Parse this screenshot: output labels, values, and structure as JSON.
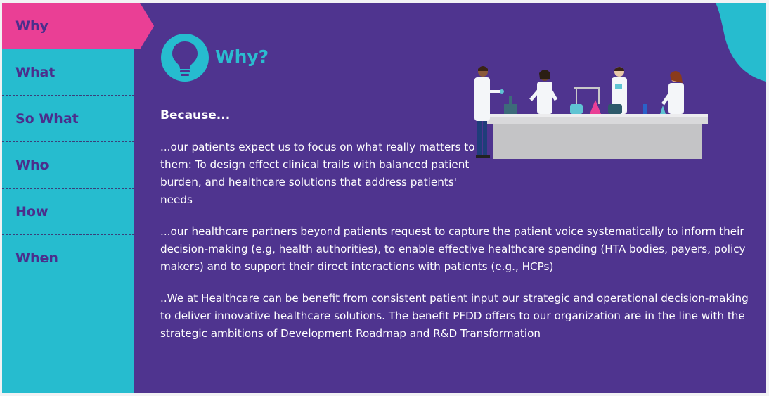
{
  "nav": {
    "items": [
      {
        "label": "Why",
        "active": true
      },
      {
        "label": "What",
        "active": false
      },
      {
        "label": "So What",
        "active": false
      },
      {
        "label": "Who",
        "active": false
      },
      {
        "label": "How",
        "active": false
      },
      {
        "label": "When",
        "active": false
      }
    ]
  },
  "main": {
    "heading": "Why?",
    "intro": "Because...",
    "paragraphs": [
      "...our patients expect us to focus on what really matters to them: To design effect clinical trails with balanced patient burden, and healthcare solutions that address patients' needs",
      "...our healthcare partners beyond patients request to capture the patient voice systematically to inform their decision-making (e.g, health authorities), to enable effective healthcare spending (HTA bodies, payers, policy makers) and to support their direct interactions with patients (e.g., HCPs)",
      "..We at Healthcare can be benefit from consistent patient input our strategic and operational decision-making to deliver innovative healthcare solutions. The benefit PFDD offers to our organization are in the line with the strategic ambitions of Development Roadmap and R&D Transformation"
    ]
  },
  "icons": {
    "header_icon": "lightbulb-icon",
    "illustration": "scientists-lab-illustration"
  },
  "colors": {
    "background": "#4f348f",
    "sidebar": "#26bccf",
    "active_tab": "#ea3f95",
    "accent": "#2bbcd0",
    "nav_text": "#4b2e8c"
  }
}
